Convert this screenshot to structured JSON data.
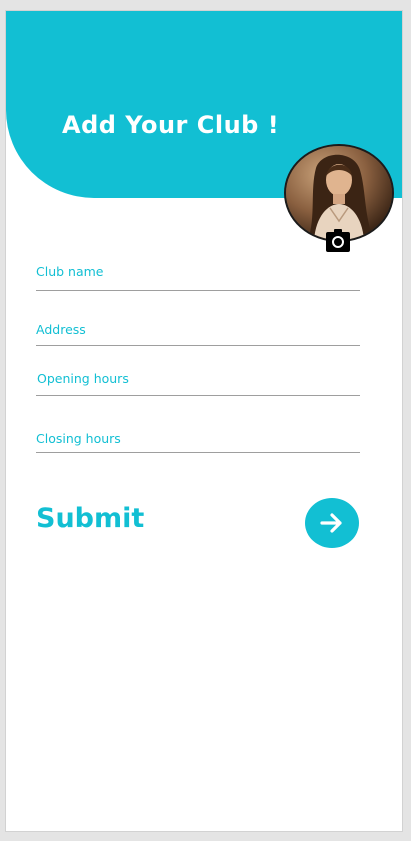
{
  "header": {
    "title": "Add Your Club !"
  },
  "avatar": {
    "icon": "profile-photo",
    "camera_icon": "camera-icon"
  },
  "form": {
    "fields": [
      {
        "label": "Club name",
        "value": ""
      },
      {
        "label": "Address",
        "value": ""
      },
      {
        "label": "Opening hours",
        "value": ""
      },
      {
        "label": "Closing hours",
        "value": ""
      }
    ],
    "submit_label": "Submit",
    "submit_icon": "arrow-right-icon"
  },
  "colors": {
    "accent": "#12bfd3",
    "background": "#ffffff",
    "divider": "#9e9e9e"
  }
}
